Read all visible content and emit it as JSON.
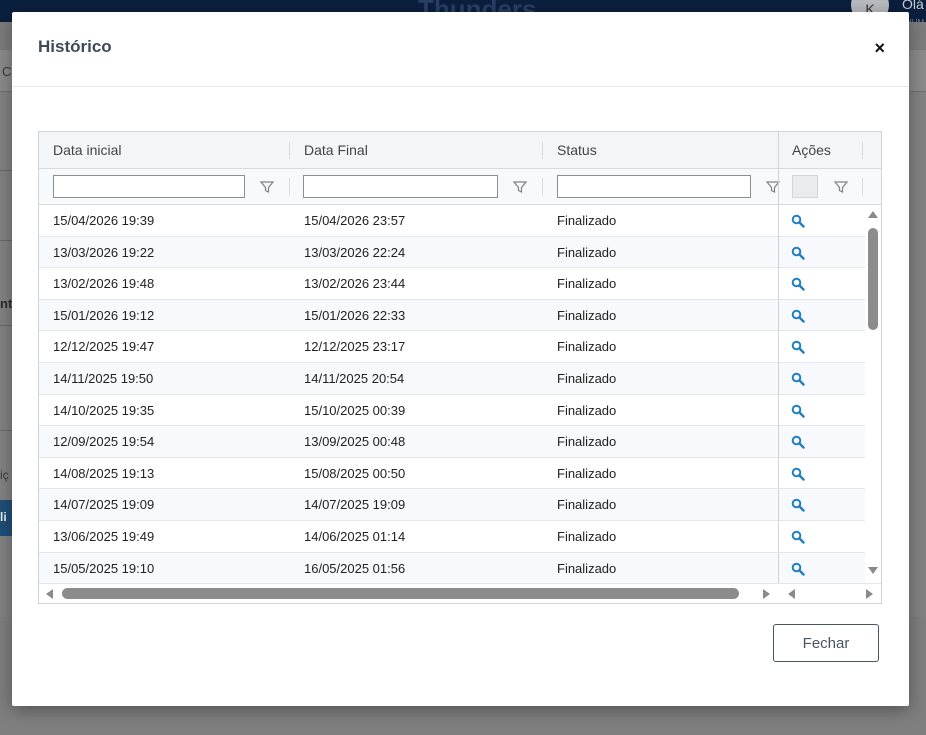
{
  "background": {
    "brand": "Thunders",
    "avatar_initial": "K",
    "greeting": "Olá",
    "greeting_sub": "HUM",
    "band_fragment": "C",
    "fragment_1": "nt",
    "fragment_2": "iç",
    "fragment_3": "li"
  },
  "dialog": {
    "title": "Histórico",
    "close_symbol": "×",
    "close_button_label": "Fechar"
  },
  "grid": {
    "columns": [
      "Data inicial",
      "Data Final",
      "Status",
      "Ações"
    ],
    "filter_values": [
      "",
      "",
      ""
    ],
    "rows": [
      {
        "start": "15/04/2026 19:39",
        "end": "15/04/2026 23:57",
        "status": "Finalizado"
      },
      {
        "start": "13/03/2026 19:22",
        "end": "13/03/2026 22:24",
        "status": "Finalizado"
      },
      {
        "start": "13/02/2026 19:48",
        "end": "13/02/2026 23:44",
        "status": "Finalizado"
      },
      {
        "start": "15/01/2026 19:12",
        "end": "15/01/2026 22:33",
        "status": "Finalizado"
      },
      {
        "start": "12/12/2025 19:47",
        "end": "12/12/2025 23:17",
        "status": "Finalizado"
      },
      {
        "start": "14/11/2025 19:50",
        "end": "14/11/2025 20:54",
        "status": "Finalizado"
      },
      {
        "start": "14/10/2025 19:35",
        "end": "15/10/2025 00:39",
        "status": "Finalizado"
      },
      {
        "start": "12/09/2025 19:54",
        "end": "13/09/2025 00:48",
        "status": "Finalizado"
      },
      {
        "start": "14/08/2025 19:13",
        "end": "15/08/2025 00:50",
        "status": "Finalizado"
      },
      {
        "start": "14/07/2025 19:09",
        "end": "14/07/2025 19:09",
        "status": "Finalizado"
      },
      {
        "start": "13/06/2025 19:49",
        "end": "14/06/2025 01:14",
        "status": "Finalizado"
      },
      {
        "start": "15/05/2025 19:10",
        "end": "16/05/2025 01:56",
        "status": "Finalizado"
      }
    ],
    "action_icon": "search-icon",
    "filter_icon": "filter-icon"
  },
  "colors": {
    "action_icon": "#1f7fc4",
    "title": "#3f4a55",
    "row_alt": "#f7f9fc"
  }
}
